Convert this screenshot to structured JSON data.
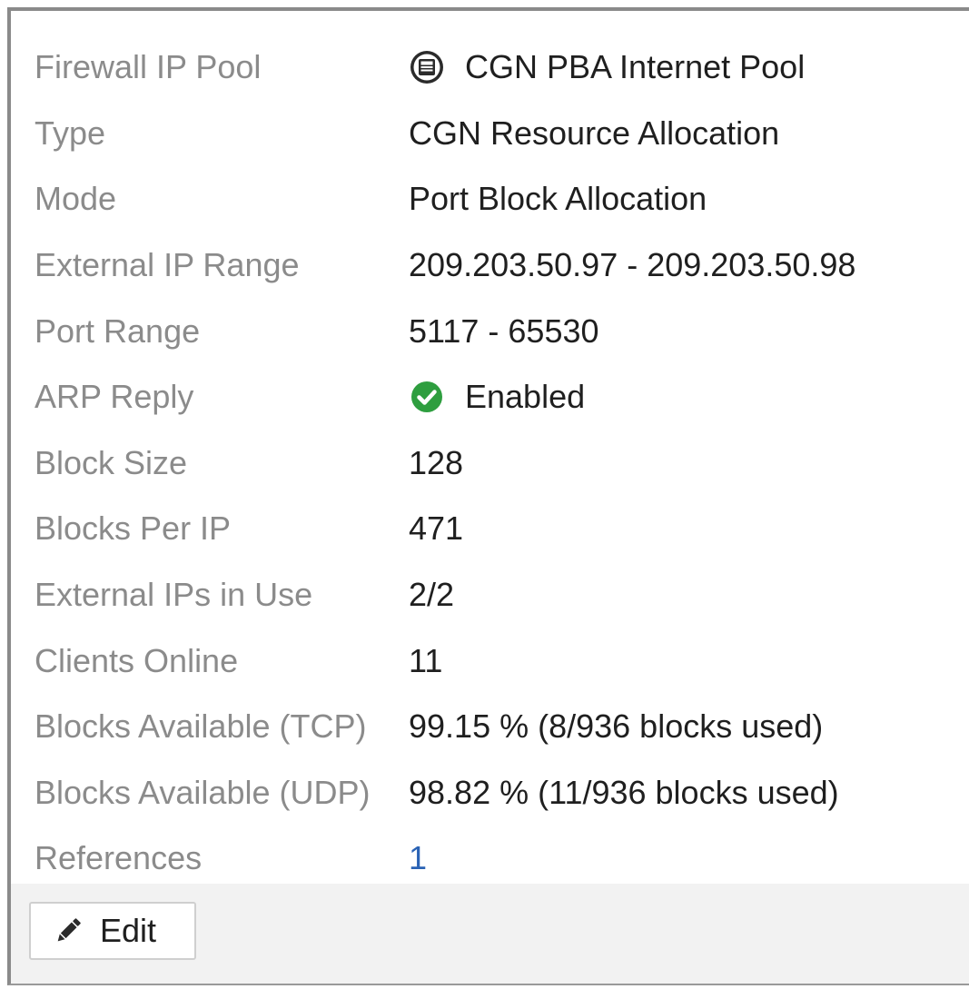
{
  "details": {
    "rows": [
      {
        "label": "Firewall IP Pool",
        "value": "CGN PBA Internet Pool",
        "icon": "ip-pool-icon"
      },
      {
        "label": "Type",
        "value": "CGN Resource Allocation"
      },
      {
        "label": "Mode",
        "value": "Port Block Allocation"
      },
      {
        "label": "External IP Range",
        "value": "209.203.50.97 - 209.203.50.98"
      },
      {
        "label": "Port Range",
        "value": "5117 - 65530"
      },
      {
        "label": "ARP Reply",
        "value": "Enabled",
        "icon": "check-circle-icon"
      },
      {
        "label": "Block Size",
        "value": "128"
      },
      {
        "label": "Blocks Per IP",
        "value": "471"
      },
      {
        "label": "External IPs in Use",
        "value": "2/2"
      },
      {
        "label": "Clients Online",
        "value": "11"
      },
      {
        "label": "Blocks Available (TCP)",
        "value": "99.15 % (8/936 blocks used)"
      },
      {
        "label": "Blocks Available (UDP)",
        "value": "98.82 % (11/936 blocks used)"
      },
      {
        "label": "References",
        "value": "1"
      }
    ]
  },
  "footer": {
    "edit_label": "Edit",
    "edit_icon": "pencil-icon"
  },
  "colors": {
    "label": "#8b8b8b",
    "value": "#1f1f1f",
    "link": "#2a63b5",
    "enabled_green": "#2e9e3f",
    "footer_bg": "#f2f2f2"
  }
}
